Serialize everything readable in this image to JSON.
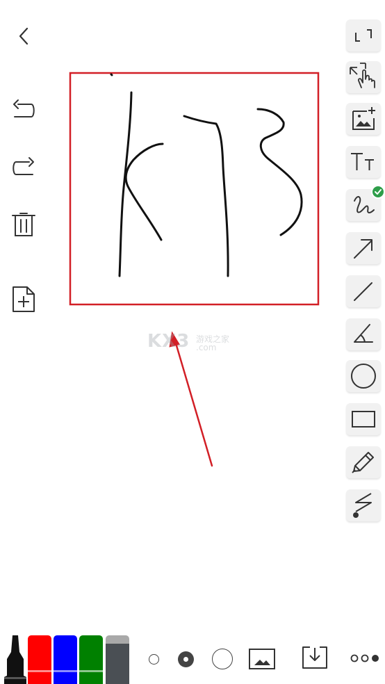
{
  "left_toolbar": {
    "icons": [
      "back-icon",
      "undo-icon",
      "redo-icon",
      "trash-icon",
      "add-page-icon"
    ]
  },
  "right_toolbar": {
    "icons": [
      "fullscreen-icon",
      "pan-zoom-hand-icon",
      "insert-image-icon",
      "text-size-icon",
      "freehand-pen-icon",
      "arrow-icon",
      "line-icon",
      "angle-icon",
      "circle-icon",
      "rectangle-icon",
      "pencil-icon",
      "laser-pointer-icon"
    ],
    "selected": "freehand-pen-icon"
  },
  "watermark": {
    "main": "KX3",
    "sub1": "游戏之家",
    "sub2": ".com"
  },
  "colors": {
    "annotation_red": "#d21f26",
    "ink": "#111111",
    "swatch_red": "#ff0000",
    "swatch_blue": "#0000ff",
    "swatch_green": "#008000",
    "eraser": "#4a4f54",
    "check": "#2e9e4a"
  },
  "bottom_bar": {
    "pens": [
      "black-marker",
      "red-marker",
      "blue-marker",
      "green-marker",
      "eraser"
    ],
    "stroke_sizes": [
      "small",
      "medium",
      "large"
    ],
    "selected_size": "medium",
    "icons": [
      "background-image-icon",
      "save-download-icon",
      "more-icon"
    ]
  }
}
